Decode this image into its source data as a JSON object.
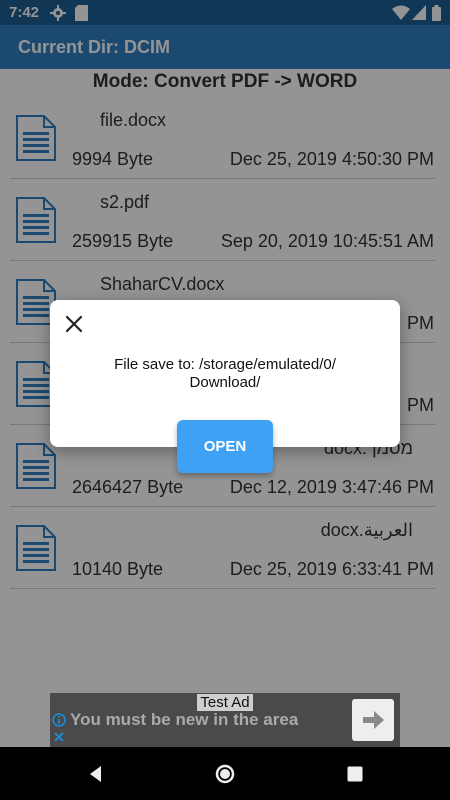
{
  "status_bar": {
    "time": "7:42"
  },
  "app_bar": {
    "title": "Current Dir: DCIM"
  },
  "mode_label": "Mode: Convert PDF -> WORD",
  "files": [
    {
      "name": "file.docx",
      "size": "9994 Byte",
      "date": "Dec 25, 2019 4:50:30 PM",
      "rtl": false
    },
    {
      "name": "s2.pdf",
      "size": "259915 Byte",
      "date": "Sep 20, 2019 10:45:51 AM",
      "rtl": false
    },
    {
      "name": "ShaharCV.docx",
      "size": "",
      "date": "PM",
      "rtl": false
    },
    {
      "name": "",
      "size": "",
      "date": "PM",
      "rtl": false
    },
    {
      "name": "מסמך.docx",
      "size": "2646427 Byte",
      "date": "Dec 12, 2019 3:47:46 PM",
      "rtl": true
    },
    {
      "name": "العربية.docx",
      "size": "10140 Byte",
      "date": "Dec 25, 2019 6:33:41 PM",
      "rtl": true
    }
  ],
  "dialog": {
    "message_line1": "File save to: /storage/emulated/0/",
    "message_line2": "Download/",
    "open_label": "OPEN"
  },
  "ad": {
    "label": "Test Ad",
    "text": "You must be new in the area"
  },
  "colors": {
    "status_bar": "#1c5f93",
    "app_bar": "#2f7fc1",
    "file_icon": "#2f7fc1",
    "open_button": "#3fa1f4"
  }
}
